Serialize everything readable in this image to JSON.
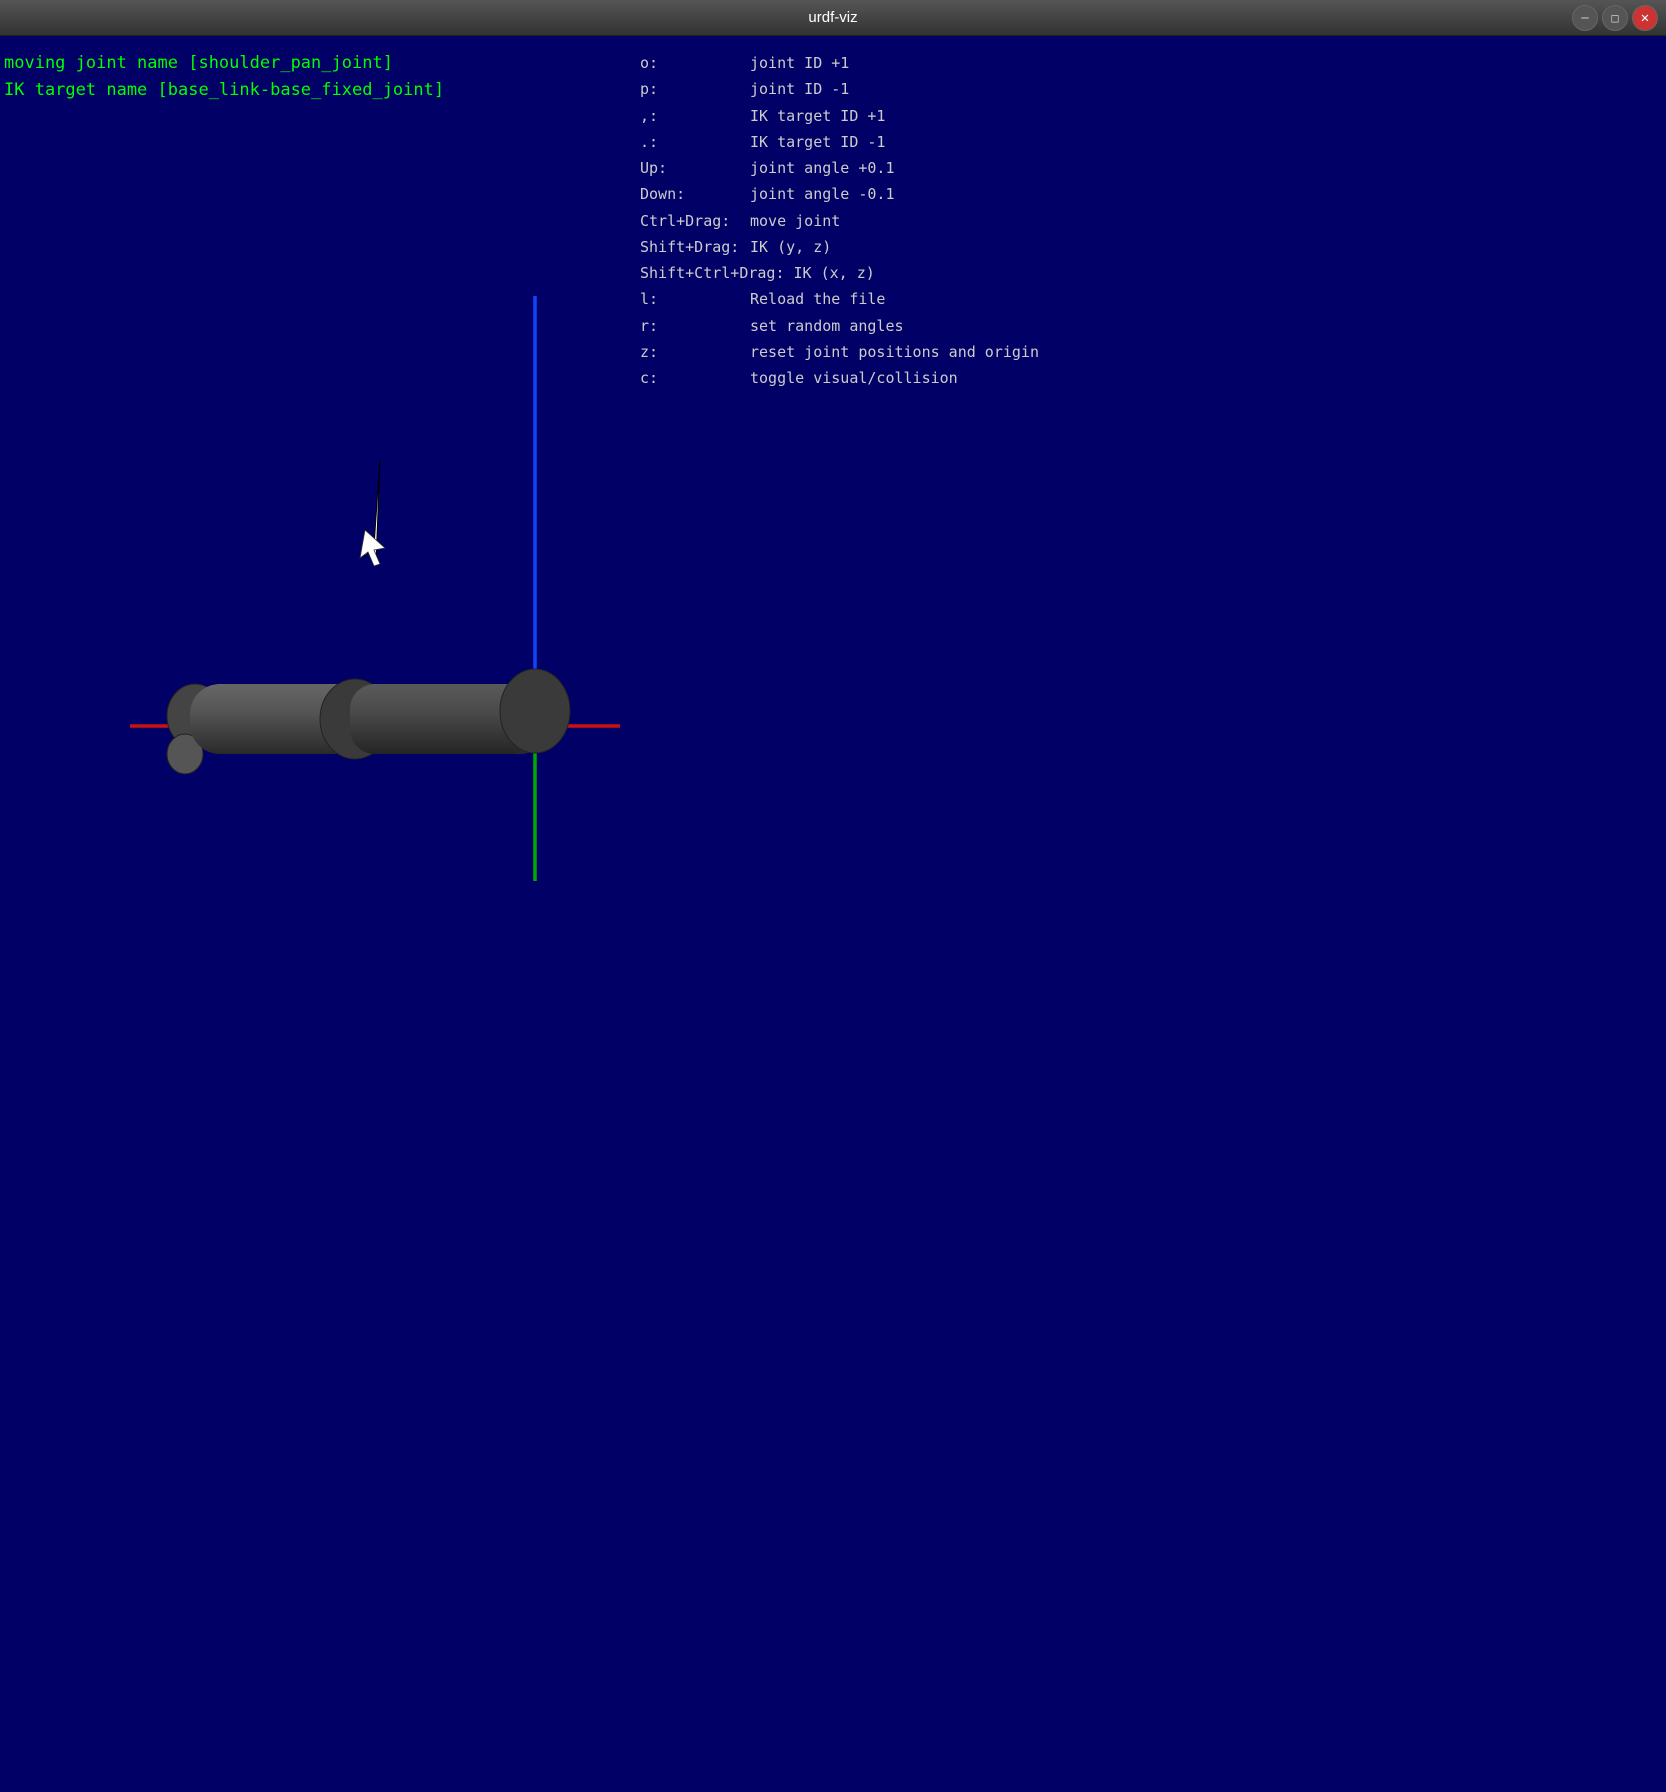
{
  "titlebar": {
    "title": "urdf-viz",
    "minimize_label": "─",
    "maximize_label": "□",
    "close_label": "✕"
  },
  "info": {
    "moving_joint_label": "moving joint name [shoulder_pan_joint]",
    "ik_target_label": "IK target name [base_link-base_fixed_joint]"
  },
  "keybindings": [
    {
      "key": "o:",
      "desc": "joint ID +1"
    },
    {
      "key": "p:",
      "desc": "joint ID -1"
    },
    {
      "key": ",:",
      "desc": "IK target ID +1"
    },
    {
      "key": ".:",
      "desc": "IK target ID -1"
    },
    {
      "key": "Up:",
      "desc": "joint angle +0.1"
    },
    {
      "key": "Down:",
      "desc": "joint angle -0.1"
    },
    {
      "key": "Ctrl+Drag:",
      "desc": "move joint"
    },
    {
      "key": "Shift+Drag:",
      "desc": "IK (y, z)"
    },
    {
      "key": "Shift+Ctrl+Drag:",
      "desc": "IK (x, z)"
    },
    {
      "key": "l:",
      "desc": "Reload the file"
    },
    {
      "key": "r:",
      "desc": "set random angles"
    },
    {
      "key": "z:",
      "desc": "reset joint positions and origin"
    },
    {
      "key": "c:",
      "desc": "toggle visual/collision"
    }
  ],
  "colors": {
    "background": "#000066",
    "text": "#cccccc",
    "joint_color": "#00ff00",
    "axis_red": "#cc0000",
    "axis_blue": "#0055ff",
    "axis_green": "#00aa00"
  }
}
